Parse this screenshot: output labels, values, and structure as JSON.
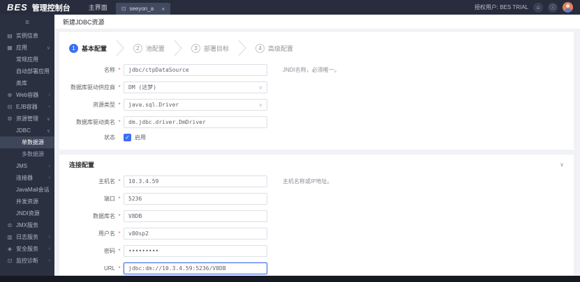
{
  "colors": {
    "accent": "#3d6ef5",
    "header_bg": "#272d3d",
    "sidebar_bg": "#2a3040",
    "sidebar_active_bg": "#3e4659",
    "avatar_bg": "#e8805a",
    "required_mark": "#f05a5a",
    "main_bg": "#f0f2f5"
  },
  "symbols": {
    "required": "*",
    "chevron_down": "∨",
    "chevron_right": "›",
    "select_arrow": "∨",
    "close": "×",
    "check": "✓",
    "collapse": "≡",
    "home": "⌂",
    "info": "ⓘ"
  },
  "icons": {
    "tab": "⊡",
    "instance": "▤",
    "apps": "▦",
    "web": "⊕",
    "ejb": "⊟",
    "resource": "⚙",
    "jmx": "⊜",
    "log": "▥",
    "security": "◈",
    "monitor": "⊡"
  },
  "header": {
    "logo": "BES",
    "product": "管理控制台",
    "main_menu": "主界面",
    "tab_label": "seeyon_a",
    "user_label": "授权用户: BES TRIAL"
  },
  "sidebar": {
    "items": [
      {
        "label": "实例信息"
      },
      {
        "label": "应用"
      },
      {
        "label": "常规应用"
      },
      {
        "label": "自动部署应用"
      },
      {
        "label": "类库"
      },
      {
        "label": "Web容器"
      },
      {
        "label": "EJB容器"
      },
      {
        "label": "资源管理"
      },
      {
        "label": "JDBC"
      },
      {
        "label": "单数据源",
        "active": true
      },
      {
        "label": "多数据源"
      },
      {
        "label": "JMS"
      },
      {
        "label": "连接器"
      },
      {
        "label": "JavaMail会话"
      },
      {
        "label": "并发资源"
      },
      {
        "label": "JNDI资源"
      },
      {
        "label": "JMX服务"
      },
      {
        "label": "日志服务"
      },
      {
        "label": "安全服务"
      },
      {
        "label": "监控诊断"
      }
    ]
  },
  "page": {
    "title": "新建JDBC资源",
    "steps": [
      {
        "num": "1",
        "label": "基本配置"
      },
      {
        "num": "2",
        "label": "池配置"
      },
      {
        "num": "3",
        "label": "部署目标"
      },
      {
        "num": "4",
        "label": "高级配置"
      }
    ],
    "basic": {
      "fields": [
        {
          "label": "名称",
          "value": "jdbc/ctpDataSource",
          "hint": "JNDI名称，必须唯一。"
        },
        {
          "label": "数据库驱动供应商",
          "value": "DM (达梦)"
        },
        {
          "label": "资源类型",
          "value": "java.sql.Driver"
        },
        {
          "label": "数据库驱动类名",
          "value": "dm.jdbc.driver.DmDriver"
        },
        {
          "label": "状态",
          "checkbox_label": "启用",
          "checked": true
        }
      ]
    },
    "connection": {
      "title": "连接配置",
      "fields": [
        {
          "label": "主机名",
          "value": "10.3.4.59",
          "hint": "主机名称或IP地址。"
        },
        {
          "label": "端口",
          "value": "5236"
        },
        {
          "label": "数据库名",
          "value": "V8DB"
        },
        {
          "label": "用户名",
          "value": "v80sp2"
        },
        {
          "label": "密码",
          "value": "•••••••••"
        },
        {
          "label": "URL",
          "value": "jdbc:dm://10.3.4.59:5236/V8DB"
        }
      ]
    }
  }
}
